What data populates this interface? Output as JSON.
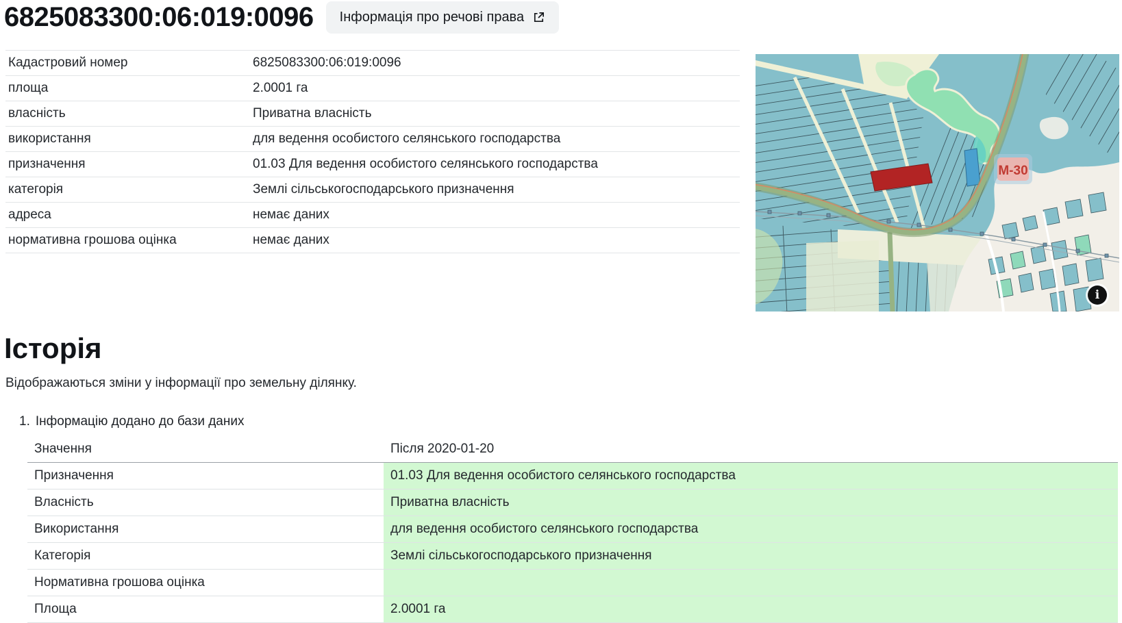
{
  "header": {
    "title": "6825083300:06:019:0096",
    "rights_button_label": "Інформація про речові права"
  },
  "info_table": {
    "rows": [
      {
        "label": "Кадастровий номер",
        "value": "6825083300:06:019:0096"
      },
      {
        "label": "площа",
        "value": "2.0001 га"
      },
      {
        "label": "власність",
        "value": "Приватна власність"
      },
      {
        "label": "використання",
        "value": "для ведення особистого селянського господарства"
      },
      {
        "label": "призначення",
        "value": "01.03 Для ведення особистого селянського господарства"
      },
      {
        "label": "категорія",
        "value": "Землі сільськогосподарського призначення"
      },
      {
        "label": "адреса",
        "value": "немає даних"
      },
      {
        "label": "нормативна грошова оцінка",
        "value": "немає даних"
      }
    ]
  },
  "map": {
    "road_label": "М-30",
    "info_icon": "i",
    "colors": {
      "parcel_teal": "#85bfca",
      "parcel_border": "#3c565e",
      "road_cream": "#eff0d6",
      "water_green": "#90e0b2",
      "selected_parcel_red": "#b22424",
      "road_olive": "#97b383",
      "settlement_white": "#f2efe8"
    }
  },
  "history": {
    "heading": "Історія",
    "description": "Відображаються зміни у інформації про земельну ділянку.",
    "entries": [
      {
        "index": "1.",
        "title": "Інформацію додано до бази даних",
        "header": {
          "label": "Значення",
          "value": "Після 2020-01-20"
        },
        "rows": [
          {
            "label": "Призначення",
            "value": "01.03 Для ведення особистого селянського господарства"
          },
          {
            "label": "Власність",
            "value": "Приватна власність"
          },
          {
            "label": "Використання",
            "value": "для ведення особистого селянського господарства"
          },
          {
            "label": "Категорія",
            "value": "Землі сільськогосподарського призначення"
          },
          {
            "label": "Нормативна грошова оцінка",
            "value": ""
          },
          {
            "label": "Площа",
            "value": "2.0001 га"
          }
        ]
      }
    ]
  }
}
